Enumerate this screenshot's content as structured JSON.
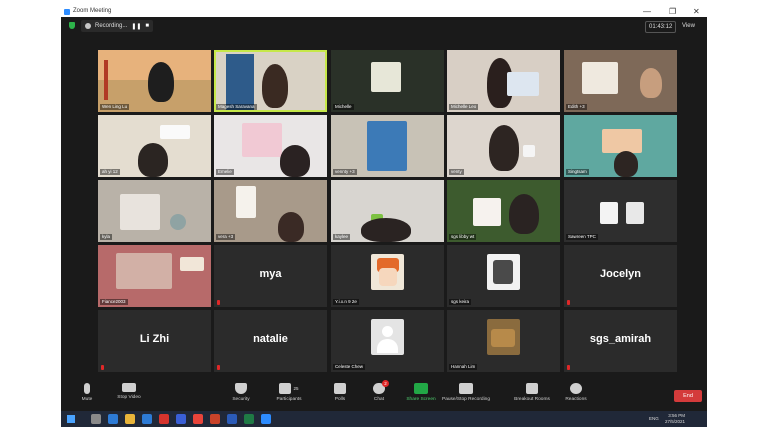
{
  "window": {
    "title": "Zoom Meeting",
    "minimize": "—",
    "restore": "❐",
    "close": "✕"
  },
  "topbar": {
    "recording_label": "Recording...",
    "pause": "❚❚",
    "stop": "■",
    "timer": "01:43:12",
    "view_label": "View"
  },
  "participants": [
    {
      "name": "Wen Ling Lu"
    },
    {
      "name": "Magesh Saravana"
    },
    {
      "name": "Michelle"
    },
    {
      "name": "Michelle Leo"
    },
    {
      "name": "Edith +3"
    },
    {
      "name": "ah yi 12"
    },
    {
      "name": "Emelie"
    },
    {
      "name": "vennty +3"
    },
    {
      "name": "venty"
    },
    {
      "name": "Singtsam"
    },
    {
      "name": "kyla"
    },
    {
      "name": "vera +3"
    },
    {
      "name": "kaylee"
    },
    {
      "name": "sgs libby wt"
    },
    {
      "name": "Sawreen TPC"
    },
    {
      "name": "Fiance2003"
    },
    {
      "name": "mya",
      "big": "mya"
    },
    {
      "name": "Y.i.x.n 9 2e"
    },
    {
      "name": "sgs keira"
    },
    {
      "name": "Jocelyn",
      "big": "Jocelyn"
    },
    {
      "name": "Li Zhi",
      "big": "Li Zhi"
    },
    {
      "name": "natalie",
      "big": "natalie"
    },
    {
      "name": "Celeste Chew"
    },
    {
      "name": "Hannah Lim"
    },
    {
      "name": "sgs_amirah",
      "big": "sgs_amirah"
    }
  ],
  "toolbar": {
    "mute": "Mute",
    "stop_video": "Stop Video",
    "security": "Security",
    "participants": "Participants",
    "participants_count": "25",
    "polls": "Polls",
    "chat": "Chat",
    "chat_badge": "2",
    "share_screen": "Share Screen",
    "pause_stop_recording": "Pause/Stop Recording",
    "breakout_rooms": "Breakout Rooms",
    "reactions": "Reactions",
    "end": "End"
  },
  "taskbar": {
    "lang": "ENG",
    "time": "3:56 PM",
    "date": "27/5/2021"
  }
}
